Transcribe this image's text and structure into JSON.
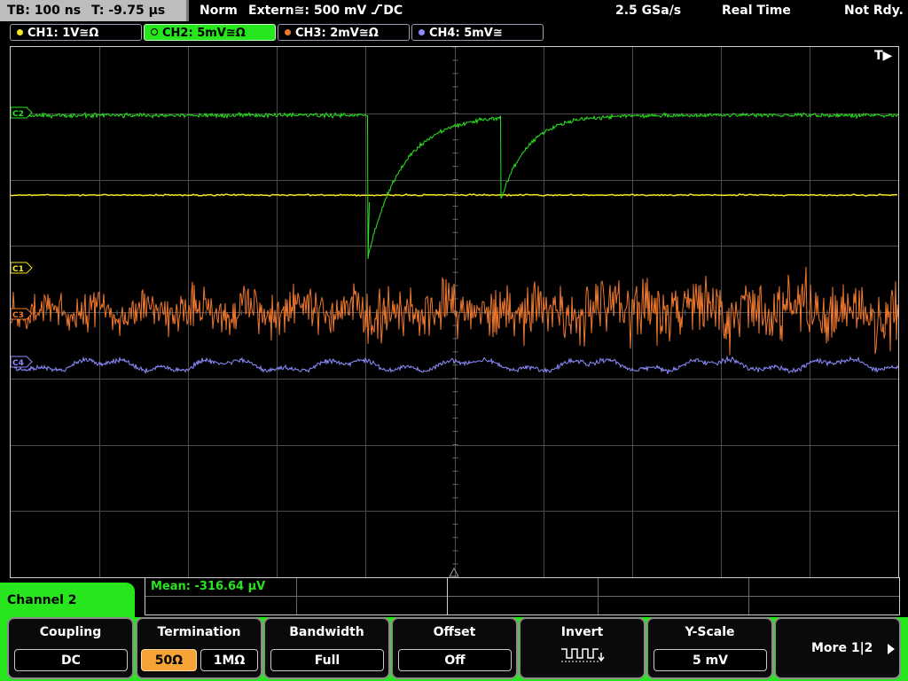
{
  "topbar": {
    "timebase": "TB: 100 ns",
    "trigger_time": "T: -9.75 µs",
    "mode": "Norm",
    "trigger_source": "Extern≅: 500 mV",
    "trigger_edge": "DC",
    "sample_rate": "2.5 GSa/s",
    "acq_mode": "Real Time",
    "status": "Not Rdy."
  },
  "channels": [
    {
      "label": "CH1: 1V≅Ω",
      "color": "#f5e61e",
      "active": false
    },
    {
      "label": "CH2: 5mV≅Ω",
      "color": "#28e61e",
      "active": true
    },
    {
      "label": "CH3: 2mV≅Ω",
      "color": "#f0782d",
      "active": false
    },
    {
      "label": "CH4: 5mV≅",
      "color": "#8c8cff",
      "active": false
    }
  ],
  "screen": {
    "trigger_marker": "T▶",
    "markers": {
      "ch1": "C1",
      "ch2": "C2",
      "ch3": "C3",
      "ch4": "C4"
    }
  },
  "measurement": {
    "label": "Mean: -316.64 µV"
  },
  "menu": {
    "title": "Channel 2",
    "softkeys": {
      "coupling": {
        "title": "Coupling",
        "value": "DC"
      },
      "termination": {
        "title": "Termination",
        "opt1": "50Ω",
        "opt2": "1MΩ",
        "selected": "50Ω"
      },
      "bandwidth": {
        "title": "Bandwidth",
        "value": "Full"
      },
      "offset": {
        "title": "Offset",
        "value": "Off"
      },
      "invert": {
        "title": "Invert",
        "icon": "square-wave-invert-icon"
      },
      "yscale": {
        "title": "Y-Scale",
        "value": "5 mV"
      },
      "more": {
        "label": "More 1|2",
        "icon": "arrow-right-icon"
      }
    }
  },
  "colors": {
    "ch1": "#f5e61e",
    "ch2": "#28e61e",
    "ch3": "#f0782d",
    "ch4": "#8c8cff",
    "menu_accent": "#28e61e",
    "selected": "#f7a436",
    "grid": "#4a4a4a"
  }
}
